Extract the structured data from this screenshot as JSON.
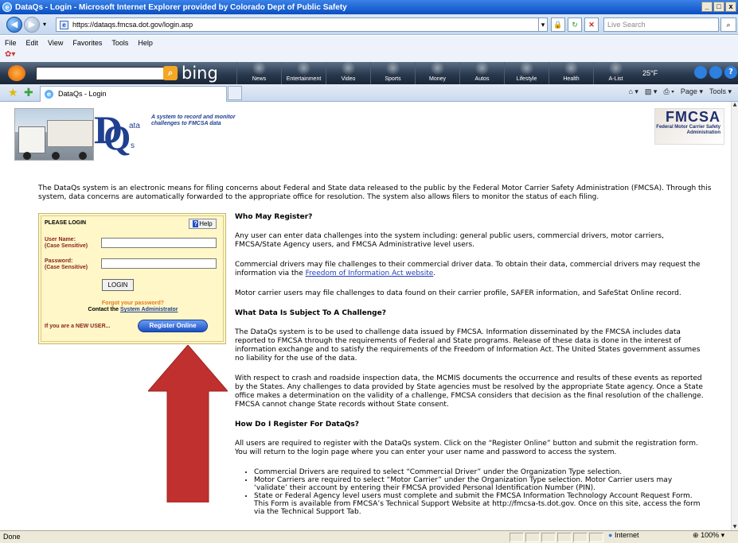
{
  "window": {
    "title": "DataQs - Login - Microsoft Internet Explorer provided by Colorado Dept of Public Safety"
  },
  "address": {
    "url": "https://dataqs.fmcsa.dot.gov/login.asp",
    "live_search_placeholder": "Live Search"
  },
  "menu": [
    "File",
    "Edit",
    "View",
    "Favorites",
    "Tools",
    "Help"
  ],
  "bing": {
    "logo": "bing",
    "tabs": [
      "News",
      "Entertainment",
      "Video",
      "Sports",
      "Money",
      "Autos",
      "Lifestyle",
      "Health",
      "A-List"
    ],
    "temperature": "25°F"
  },
  "tab": {
    "label": "DataQs - Login",
    "commands": [
      "Page ▾",
      "Tools ▾"
    ]
  },
  "header": {
    "logo_text": {
      "d": "D",
      "ata": "ata",
      "q": "Q",
      "s": "s"
    },
    "tagline": "A system to record and monitor challenges to FMCSA data",
    "fmcsa_big": "FMCSA",
    "fmcsa_small": "Federal Motor Carrier Safety Administration"
  },
  "intro": "The DataQs system is an electronic means for filing concerns about Federal and State data released to the public by the Federal Motor Carrier Safety Administration (FMCSA). Through this system, data concerns are automatically forwarded to the appropriate office for resolution. The system also allows filers to monitor the status of each filing.",
  "login": {
    "title": "PLEASE LOGIN",
    "help": "Help",
    "username_label": "User Name:",
    "username_sub": "(Case Sensitive)",
    "username_value": "",
    "password_label": "Password:",
    "password_sub": "(Case Sensitive)",
    "password_value": "",
    "login_button": "LOGIN",
    "forgot": "Forgot your password?",
    "contact_prefix": "Contact the ",
    "contact_link": "System Administrator",
    "new_user": "If you are a NEW USER...",
    "register_button": "Register Online"
  },
  "content": {
    "h1": "Who May Register?",
    "p1": "Any user can enter data challenges into the system including: general public users, commercial drivers, motor carriers, FMCSA/State Agency users, and FMCSA Administrative level users.",
    "p2_prefix": "Commercial drivers may file challenges to their commercial driver data. To obtain their data, commercial drivers may request the information via the ",
    "p2_link": "Freedom of Information Act website",
    "p2_suffix": ".",
    "p3": "Motor carrier users may file challenges to data found on their carrier profile, SAFER information, and SafeStat Online record.",
    "h2": "What Data Is Subject To A Challenge?",
    "p4": "The DataQs system is to be used to challenge data issued by FMCSA. Information disseminated by the FMCSA includes data reported to FMCSA through the requirements of Federal and State programs. Release of these data is done in the interest of information exchange and to satisfy the requirements of the Freedom of Information Act. The United States government assumes no liability for the use of the data.",
    "p5": "With respect to crash and roadside inspection data, the MCMIS documents the occurrence and results of these events as reported by the States. Any challenges to data provided by State agencies must be resolved by the appropriate State agency. Once a State office makes a determination on the validity of a challenge, FMCSA considers that decision as the final resolution of the challenge. FMCSA cannot change State records without State consent.",
    "h3": "How Do I Register For DataQs?",
    "p6": "All users are required to register with the DataQs system. Click on the “Register Online” button and submit the registration form. You will return to the login page where you can enter your user name and password to access the system.",
    "bullets": [
      "Commercial Drivers are required to select “Commercial Driver” under the Organization Type selection.",
      "Motor Carriers are required to select “Motor Carrier” under the Organization Type selection. Motor Carrier users may ‘validate’ their account by entering their FMCSA provided Personal Identification Number (PIN).",
      "State or Federal Agency level users must complete and submit the FMCSA Information Technology Account Request Form. This Form is available from FMCSA’s Technical Support Website at http://fmcsa-ts.dot.gov. Once on this site, access the form via the Technical Support Tab."
    ]
  },
  "status": {
    "left": "Done",
    "zone": "Internet",
    "zoom": "100%"
  },
  "colors": {
    "arrow": "#c0302f",
    "title_bar": "#0b4fc2",
    "login_bg": "#fff7c7"
  }
}
